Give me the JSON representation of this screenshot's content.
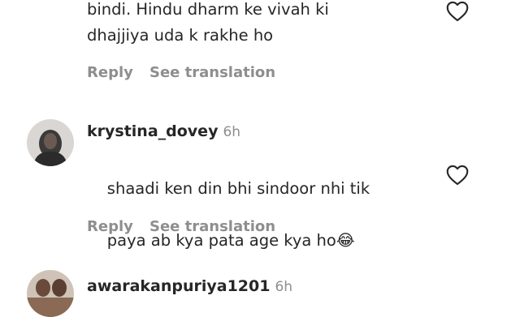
{
  "comments": [
    {
      "text": "bindi. Hindu dharm ke vivah ki\ndhajjiya uda k rakhe ho",
      "reply_label": "Reply",
      "translation_label": "See translation",
      "like_icon": "heart-outline-icon"
    },
    {
      "username": "krystina_dovey",
      "time": "6h",
      "text_line1": "shaadi ken din bhi sindoor nhi tik",
      "text_line2": "paya ab kya pata age kya ho",
      "emoji": "😂",
      "reply_label": "Reply",
      "translation_label": "See translation",
      "like_icon": "heart-outline-icon"
    },
    {
      "username": "awarakanpuriya1201",
      "time": "6h"
    }
  ],
  "colors": {
    "text": "#262626",
    "secondary": "#8e8e8e",
    "background": "#ffffff"
  }
}
